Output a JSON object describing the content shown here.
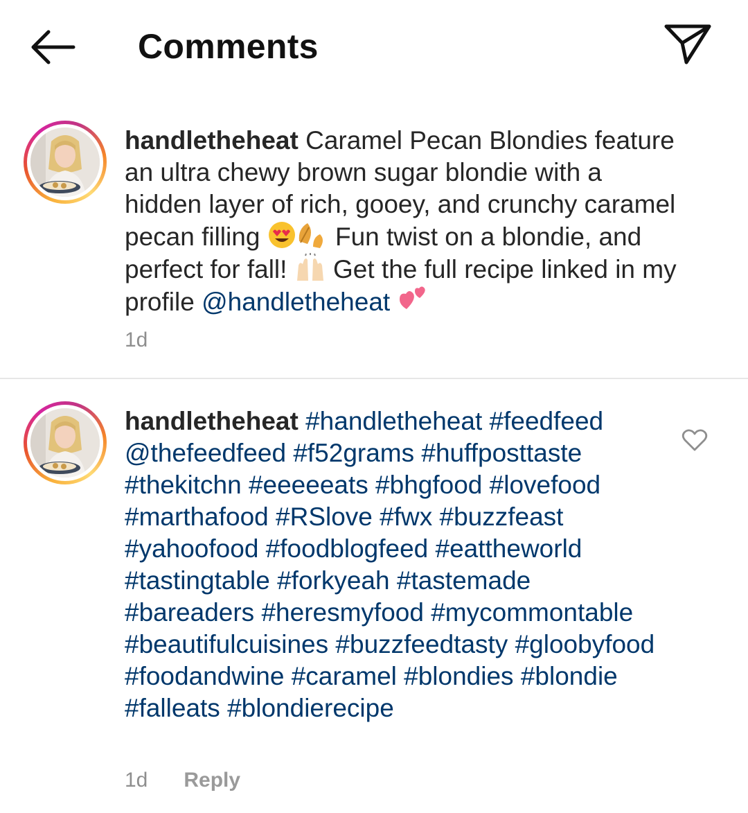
{
  "header": {
    "title": "Comments",
    "back_icon": "arrow-left-icon",
    "share_icon": "paper-plane-icon"
  },
  "caption": {
    "username": "handletheheat",
    "text_part1": " Caramel Pecan Blondies feature an ultra chewy brown sugar blondie with a hidden layer of rich, gooey, and crunchy caramel pecan filling ",
    "emoji1": "heart-eyes-emoji",
    "emoji2": "fallen-leaf-emoji",
    "text_part2": " Fun twist on a blondie, and perfect for fall! ",
    "emoji3": "raising-hands-emoji",
    "text_part3": " Get the full recipe linked in my profile ",
    "mention": "@handletheheat",
    "emoji4": "two-hearts-emoji",
    "time": "1d"
  },
  "comment": {
    "username": "handletheheat",
    "tags_line1": "#handletheheat #feedfeed",
    "mention": "@thefeedfeed",
    "tags_rest": "#f52grams #huffposttaste #thekitchn #eeeeeats #bhgfood #lovefood #marthafood #RSlove #fwx #buzzfeast #yahoofood #foodblogfeed #eattheworld #tastingtable #forkyeah #tastemade #bareaders #heresmyfood #mycommontable #beautifulcuisines #buzzfeedtasty #gloobyfood #foodandwine #caramel #blondies #blondie #falleats #blondierecipe",
    "time": "1d",
    "reply_label": "Reply",
    "like_icon": "heart-outline-icon"
  },
  "colors": {
    "text": "#262626",
    "link": "#00376b",
    "meta": "#8e8e8e",
    "divider": "#e6e6e6",
    "avatar_ring": [
      "#feda75",
      "#f58529",
      "#dd2a7b",
      "#8134af"
    ]
  }
}
